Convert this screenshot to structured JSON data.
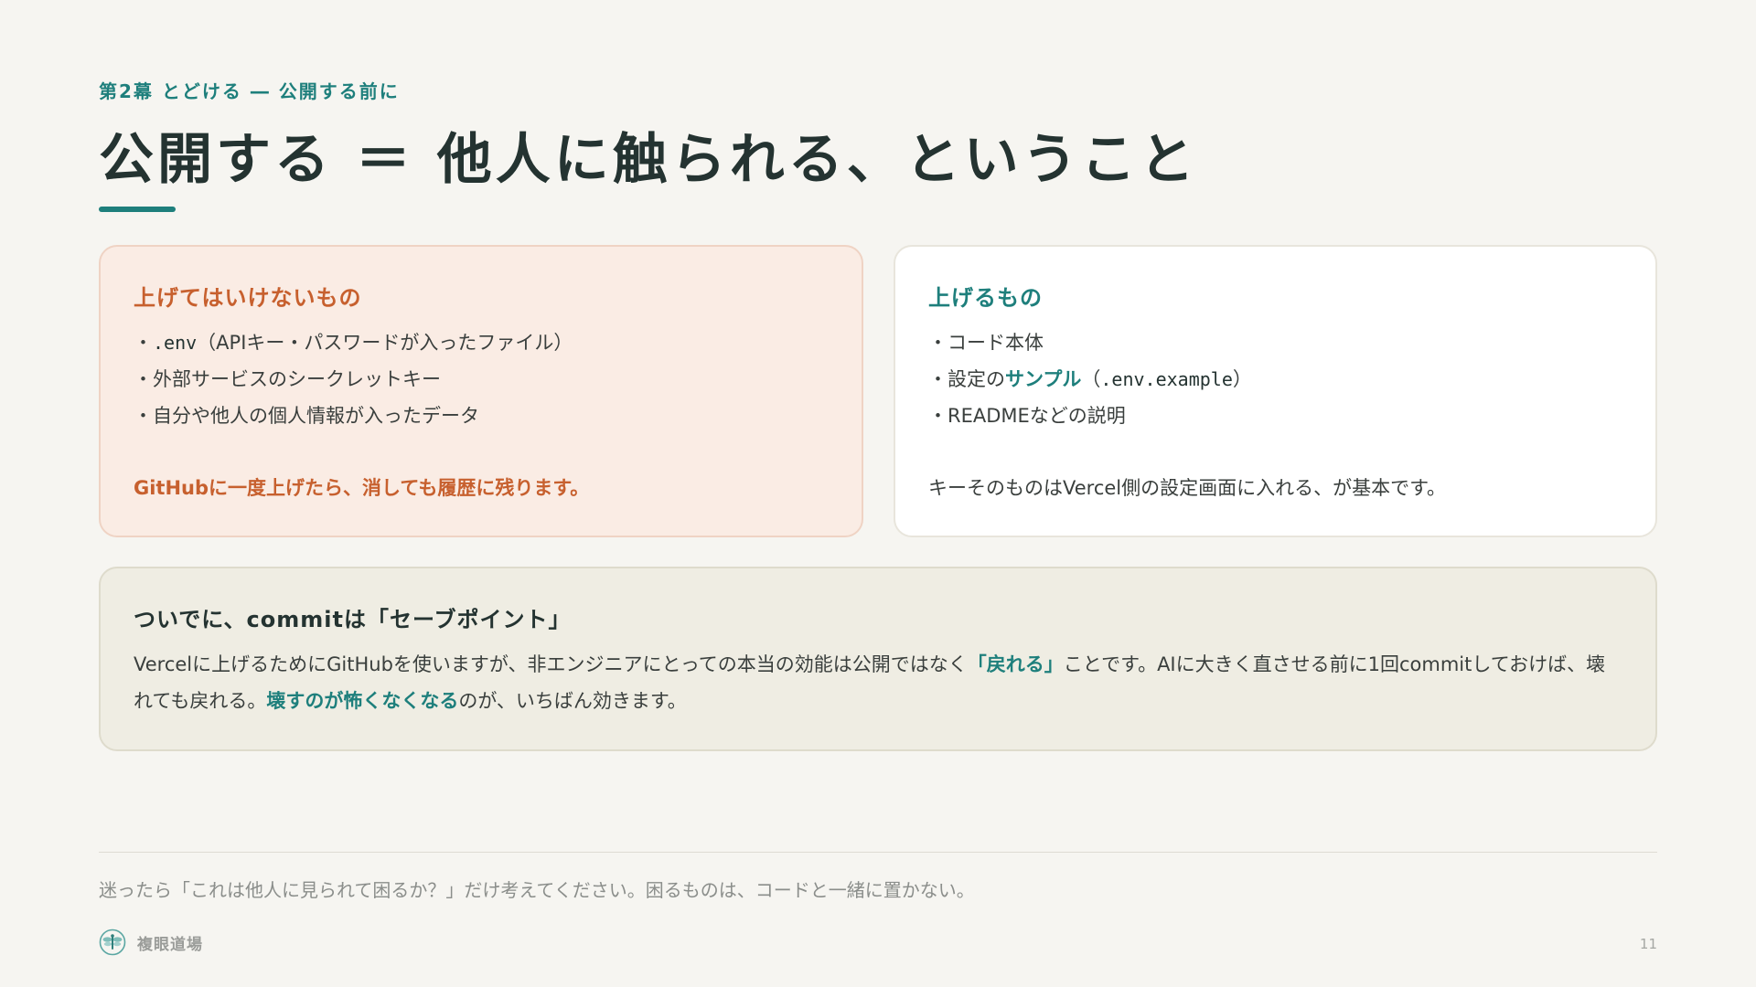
{
  "header": {
    "eyebrow": "第2幕 とどける ― 公開する前に",
    "title": "公開する ＝ 他人に触られる、ということ"
  },
  "card_bad": {
    "heading": "上げてはいけないもの",
    "items": [
      {
        "bullet": "・",
        "code": ".env",
        "text": "（APIキー・パスワードが入ったファイル）"
      },
      {
        "bullet": "・",
        "text": "外部サービスのシークレットキー"
      },
      {
        "bullet": "・",
        "text": "自分や他人の個人情報が入ったデータ"
      }
    ],
    "warning": "GitHubに一度上げたら、消しても履歴に残ります。"
  },
  "card_good": {
    "heading": "上げるもの",
    "items": [
      {
        "bullet": "・",
        "text": "コード本体"
      },
      {
        "bullet": "・",
        "prefix": "設定の",
        "highlight": "サンプル",
        "open": "（",
        "code": ".env.example",
        "close": "）"
      },
      {
        "bullet": "・",
        "text": "READMEなどの説明"
      }
    ],
    "foot": "キーそのものはVercel側の設定画面に入れる、が基本です。"
  },
  "card_note": {
    "heading": "ついでに、commitは「セーブポイント」",
    "body_1": "Vercelに上げるためにGitHubを使いますが、非エンジニアにとっての本当の効能は公開ではなく",
    "highlight_1": "「戻れる」",
    "body_2": "ことです。AIに大きく直させる前に1回commitしておけば、壊れても戻れる。",
    "highlight_2": "壊すのが怖くなくなる",
    "body_3": "のが、いちばん効きます。"
  },
  "footer": {
    "hint": "迷ったら「これは他人に見られて困るか？」だけ考えてください。困るものは、コードと一緒に置かない。",
    "brand": "複眼道場",
    "brand_icon": "dragonfly-icon",
    "page_number": "11"
  },
  "colors": {
    "accent_teal": "#1e7f7c",
    "accent_orange": "#c7602e",
    "background": "#f6f5f1"
  }
}
